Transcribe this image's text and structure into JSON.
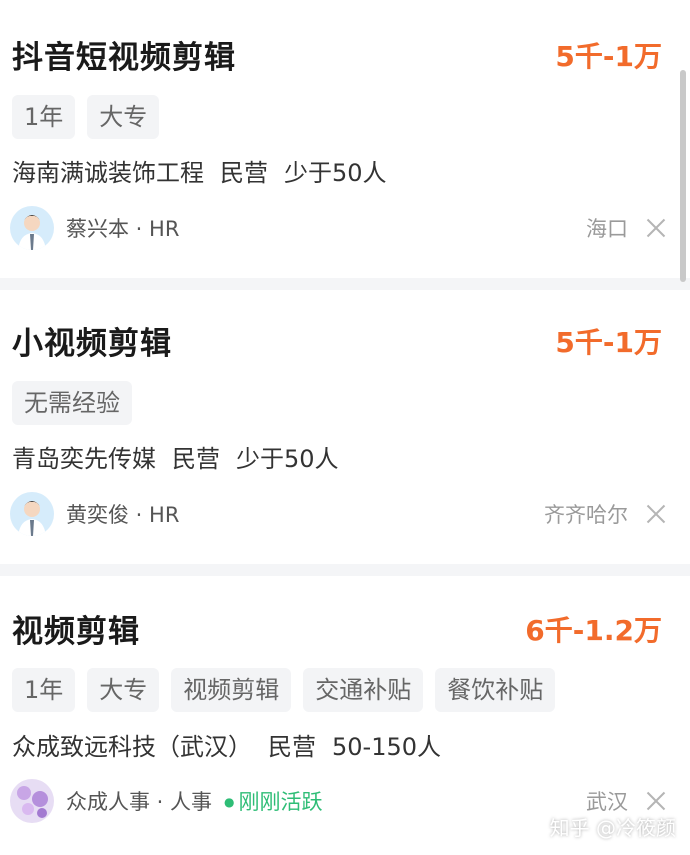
{
  "jobs": [
    {
      "title": "抖音短视频剪辑",
      "salary": "5千-1万",
      "tags": [
        "1年",
        "大专"
      ],
      "company": "海南满诚装饰工程",
      "company_type": "民营",
      "company_size": "少于50人",
      "hr_name": "蔡兴本 · HR",
      "active": "",
      "city": "海口"
    },
    {
      "title": "小视频剪辑",
      "salary": "5千-1万",
      "tags": [
        "无需经验"
      ],
      "company": "青岛奕先传媒",
      "company_type": "民营",
      "company_size": "少于50人",
      "hr_name": "黄奕俊 · HR",
      "active": "",
      "city": "齐齐哈尔"
    },
    {
      "title": "视频剪辑",
      "salary": "6千-1.2万",
      "tags": [
        "1年",
        "大专",
        "视频剪辑",
        "交通补贴",
        "餐饮补贴"
      ],
      "company": "众成致远科技（武汉）",
      "company_type": "民营",
      "company_size": "50-150人",
      "hr_name": "众成人事 · 人事",
      "active": "刚刚活跃",
      "city": "武汉"
    }
  ],
  "watermark": "知乎 @冷筱颜",
  "colors": {
    "salary": "#f26b2b",
    "active": "#2ebd76",
    "background": "#f4f5f7"
  },
  "icons": {
    "avatar": "avatar-icon",
    "close": "close-icon"
  }
}
